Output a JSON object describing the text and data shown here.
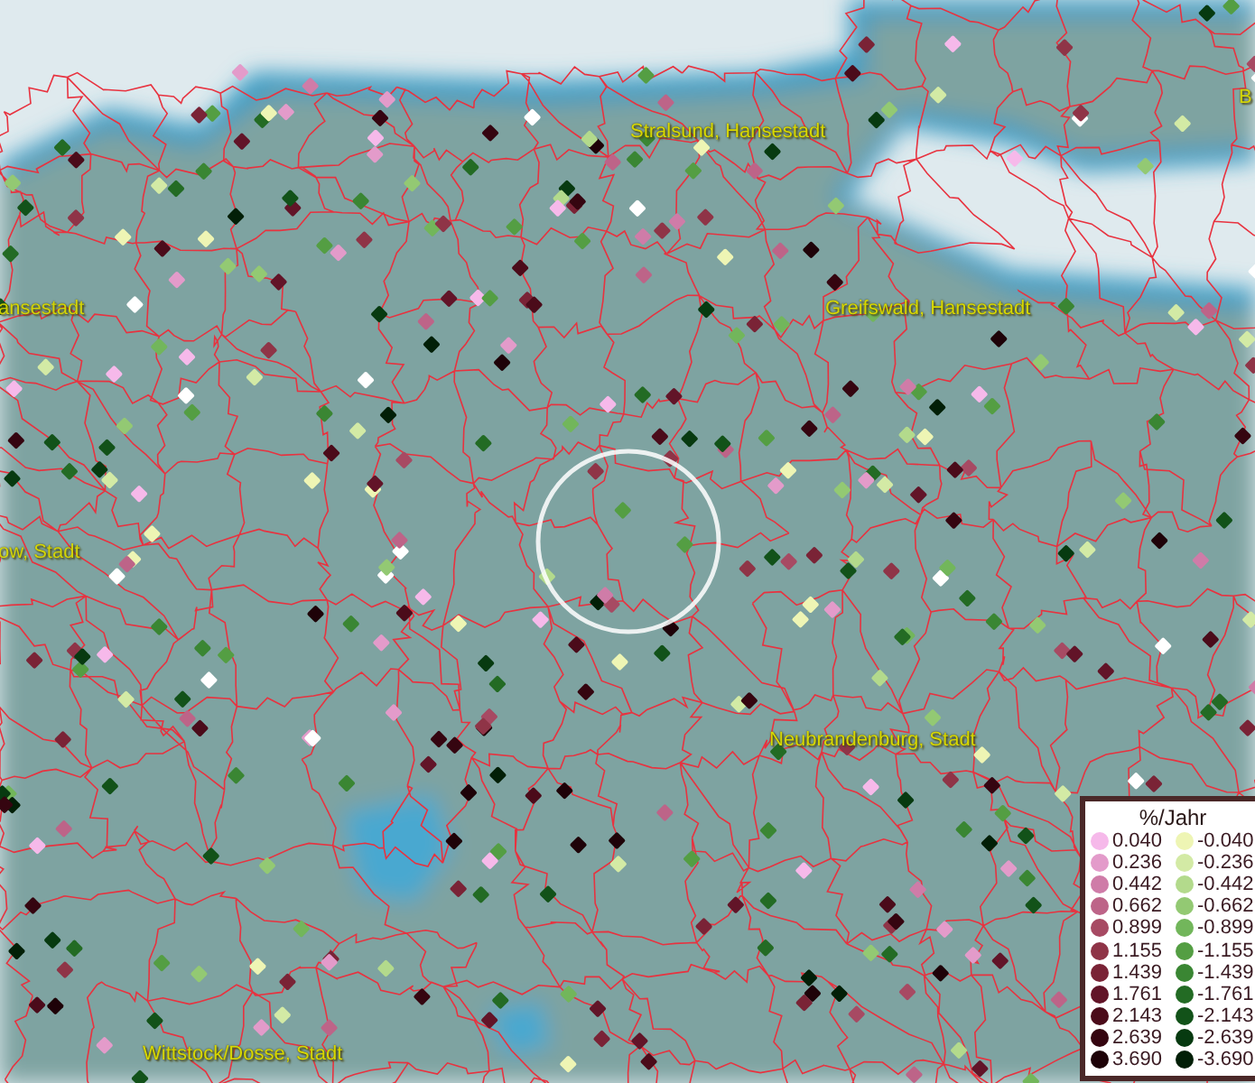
{
  "map": {
    "labels": [
      {
        "text": "Stralsund, Hansestadt",
        "kind": "full"
      },
      {
        "text": "ansestadt",
        "kind": "edge"
      },
      {
        "text": "Greifswald, Hansestadt",
        "kind": "full"
      },
      {
        "text": "ow, Stadt",
        "kind": "edge"
      },
      {
        "text": "Neubrandenburg, Stadt",
        "kind": "full"
      },
      {
        "text": "Wittstock/Dosse, Stadt",
        "kind": "full"
      },
      {
        "text": "B",
        "kind": "edge"
      }
    ]
  },
  "legend": {
    "title": "%/Jahr",
    "rows": [
      {
        "positive": {
          "label": "0.040",
          "color": "#f6b9ea"
        },
        "negative": {
          "label": "-0.040",
          "color": "#eef5b4"
        }
      },
      {
        "positive": {
          "label": "0.236",
          "color": "#e39bca"
        },
        "negative": {
          "label": "-0.236",
          "color": "#d3eaa5"
        }
      },
      {
        "positive": {
          "label": "0.442",
          "color": "#cf7ca8"
        },
        "negative": {
          "label": "-0.442",
          "color": "#b3da8c"
        }
      },
      {
        "positive": {
          "label": "0.662",
          "color": "#bd6488"
        },
        "negative": {
          "label": "-0.662",
          "color": "#93c973"
        }
      },
      {
        "positive": {
          "label": "0.899",
          "color": "#a74a63"
        },
        "negative": {
          "label": "-0.899",
          "color": "#72b65b"
        }
      },
      {
        "positive": {
          "label": "1.155",
          "color": "#8f3447"
        },
        "negative": {
          "label": "-1.155",
          "color": "#549e43"
        }
      },
      {
        "positive": {
          "label": "1.439",
          "color": "#7a2336"
        },
        "negative": {
          "label": "-1.439",
          "color": "#3a8633"
        }
      },
      {
        "positive": {
          "label": "1.761",
          "color": "#621428"
        },
        "negative": {
          "label": "-1.761",
          "color": "#236b24"
        }
      },
      {
        "positive": {
          "label": "2.143",
          "color": "#4b0b1a"
        },
        "negative": {
          "label": "-2.143",
          "color": "#125219"
        }
      },
      {
        "positive": {
          "label": "2.639",
          "color": "#350510"
        },
        "negative": {
          "label": "-2.639",
          "color": "#073a10"
        }
      },
      {
        "positive": {
          "label": "3.690",
          "color": "#1e0208"
        },
        "negative": {
          "label": "-3.690",
          "color": "#021f07"
        }
      }
    ]
  }
}
